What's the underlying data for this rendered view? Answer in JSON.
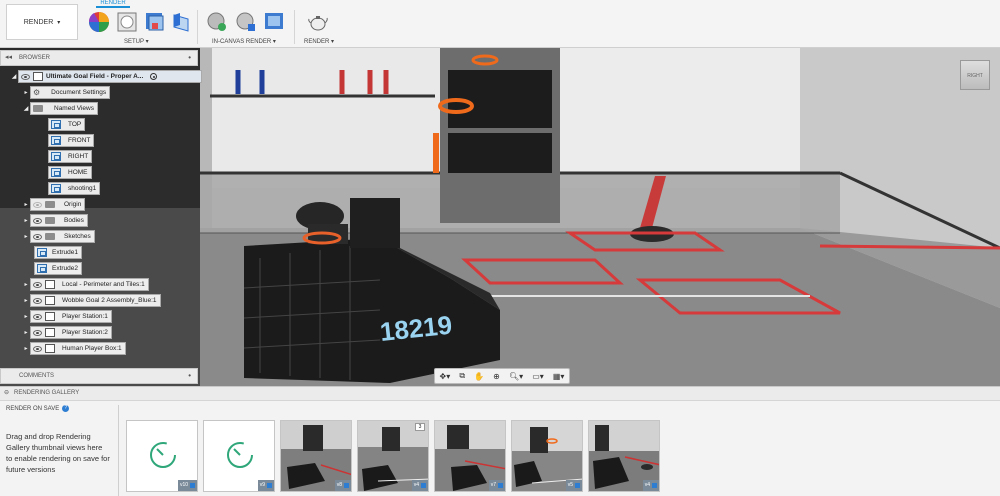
{
  "toolbar": {
    "workspace": "RENDER",
    "active_tab": "RENDER",
    "groups": {
      "setup": "SETUP",
      "in_canvas": "IN-CANVAS RENDER",
      "render": "RENDER"
    },
    "icons": [
      "appearance-icon",
      "scene-settings-icon",
      "texture-map-icon",
      "decal-icon",
      "in-canvas-render-icon",
      "in-canvas-settings-icon",
      "capture-image-icon",
      "render-teapot-icon"
    ]
  },
  "browser": {
    "title": "BROWSER",
    "root": "Ultimate Goal Field - Proper A...",
    "items": [
      {
        "label": "Document Settings"
      },
      {
        "label": "Named Views"
      },
      {
        "label": "TOP"
      },
      {
        "label": "FRONT"
      },
      {
        "label": "RIGHT"
      },
      {
        "label": "HOME"
      },
      {
        "label": "shooting1"
      },
      {
        "label": "Origin"
      },
      {
        "label": "Bodies"
      },
      {
        "label": "Sketches"
      },
      {
        "label": "Extrude1"
      },
      {
        "label": "Extrude2"
      },
      {
        "label": "Local - Perimeter and Tiles:1"
      },
      {
        "label": "Wobble Goal 2 Assembly_Blue:1"
      },
      {
        "label": "Player Station:1"
      },
      {
        "label": "Player Station:2"
      },
      {
        "label": "Human Player Box:1"
      }
    ],
    "comments": "COMMENTS"
  },
  "viewport": {
    "robot_number": "18219",
    "viewcube_label": "RIGHT"
  },
  "gallery": {
    "title": "RENDERING GALLERY",
    "render_on_save": "RENDER ON SAVE",
    "help": "?",
    "note": "Drag and drop Rendering Gallery thumbnail views here to enable rendering on save for future versions",
    "thumbs": [
      {
        "tag": "v10"
      },
      {
        "tag": "v9"
      },
      {
        "tag": "v8"
      },
      {
        "tag": "v4",
        "badge": "3"
      },
      {
        "tag": "v7"
      },
      {
        "tag": "v5"
      },
      {
        "tag": "v4"
      }
    ]
  }
}
